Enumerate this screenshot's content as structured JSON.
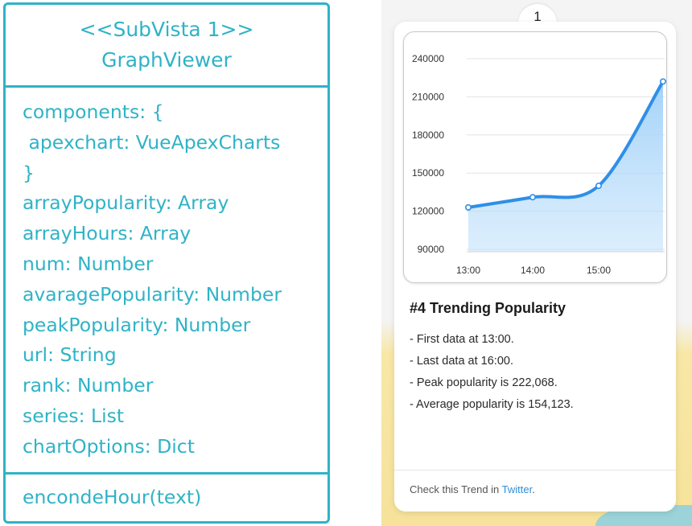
{
  "uml": {
    "stereotype": "<<SubVista 1>>",
    "class_name": "GraphViewer",
    "attributes": [
      "components: {",
      " apexchart: VueApexCharts",
      "}",
      "arrayPopularity: Array",
      "arrayHours: Array",
      "num: Number",
      "avaragePopularity: Number",
      "peakPopularity: Number",
      "url: String",
      "rank: Number",
      "series: List",
      "chartOptions: Dict"
    ],
    "methods": [
      "encondeHour(text)"
    ],
    "color": "#2fb3c6"
  },
  "card": {
    "rank": "1",
    "title": "#4 Trending Popularity",
    "lines": [
      "- First data at 13:00.",
      "- Last data at 16:00.",
      "- Peak popularity is 222,068.",
      "- Average popularity is 154,123."
    ],
    "footer_prefix": "Check this Trend in ",
    "footer_link": "Twitter",
    "footer_suffix": "."
  },
  "chart_data": {
    "type": "area",
    "x": [
      "13:00",
      "14:00",
      "15:00",
      "16:00"
    ],
    "x_tick_labels": [
      "13:00",
      "14:00",
      "15:00"
    ],
    "series": [
      {
        "values": [
          123000,
          131000,
          140000,
          222068
        ]
      }
    ],
    "y_ticks": [
      90000,
      120000,
      150000,
      180000,
      210000,
      240000
    ],
    "ylim": [
      90000,
      240000
    ],
    "grid": true,
    "line_color": "#2f8fe8",
    "fill_color": "#bfe0fb"
  }
}
